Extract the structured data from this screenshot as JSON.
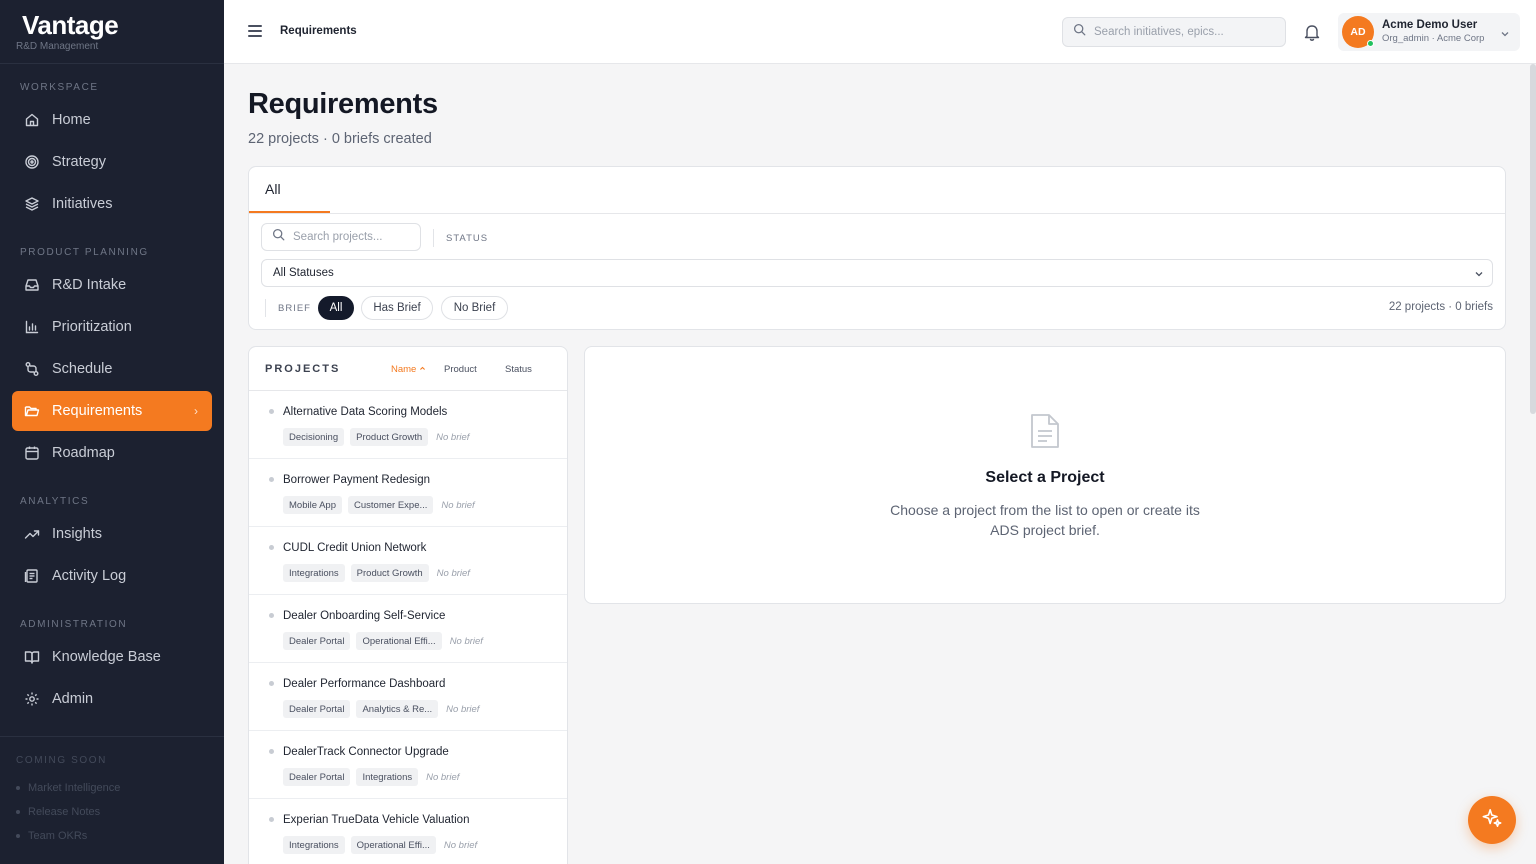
{
  "brand": {
    "name": "Vantage",
    "subtitle": "R&D Management"
  },
  "sidebar": {
    "sections": [
      {
        "label": "WORKSPACE"
      },
      {
        "label": "PRODUCT PLANNING"
      },
      {
        "label": "ANALYTICS"
      },
      {
        "label": "ADMINISTRATION"
      }
    ],
    "items": [
      {
        "label": "Home",
        "icon": "home-icon"
      },
      {
        "label": "Strategy",
        "icon": "target-icon"
      },
      {
        "label": "Initiatives",
        "icon": "layers-icon"
      },
      {
        "label": "R&D Intake",
        "icon": "inbox-icon"
      },
      {
        "label": "Prioritization",
        "icon": "bar-chart-icon"
      },
      {
        "label": "Schedule",
        "icon": "route-icon"
      },
      {
        "label": "Requirements",
        "icon": "folder-icon",
        "active": true
      },
      {
        "label": "Roadmap",
        "icon": "calendar-icon"
      },
      {
        "label": "Insights",
        "icon": "trend-icon"
      },
      {
        "label": "Activity Log",
        "icon": "log-icon"
      },
      {
        "label": "Knowledge Base",
        "icon": "book-icon"
      },
      {
        "label": "Admin",
        "icon": "gear-icon"
      }
    ],
    "coming_soon": {
      "label": "COMING SOON",
      "items": [
        "Market Intelligence",
        "Release Notes",
        "Team OKRs"
      ]
    }
  },
  "header": {
    "breadcrumb": "Requirements",
    "search_placeholder": "Search initiatives, epics...",
    "user": {
      "initials": "AD",
      "name": "Acme Demo User",
      "role": "Org_admin · Acme Corp"
    }
  },
  "page": {
    "title": "Requirements",
    "subtitle": "22 projects · 0 briefs created"
  },
  "filters": {
    "tab": "All",
    "search_placeholder": "Search projects...",
    "status_label": "STATUS",
    "status_value": "All Statuses",
    "brief_label": "BRIEF",
    "brief_options": [
      "All",
      "Has Brief",
      "No Brief"
    ],
    "brief_selected": "All",
    "summary": "22 projects · 0 briefs"
  },
  "projects": {
    "title": "PROJECTS",
    "sort_options": [
      "Name",
      "Product",
      "Status"
    ],
    "sort_active": "Name",
    "rows": [
      {
        "name": "Alternative Data Scoring Models",
        "tags": [
          "Decisioning",
          "Product Growth"
        ],
        "brief": "No brief"
      },
      {
        "name": "Borrower Payment Redesign",
        "tags": [
          "Mobile App",
          "Customer Expe..."
        ],
        "brief": "No brief"
      },
      {
        "name": "CUDL Credit Union Network",
        "tags": [
          "Integrations",
          "Product Growth"
        ],
        "brief": "No brief"
      },
      {
        "name": "Dealer Onboarding Self-Service",
        "tags": [
          "Dealer Portal",
          "Operational Effi..."
        ],
        "brief": "No brief"
      },
      {
        "name": "Dealer Performance Dashboard",
        "tags": [
          "Dealer Portal",
          "Analytics & Re..."
        ],
        "brief": "No brief"
      },
      {
        "name": "DealerTrack Connector Upgrade",
        "tags": [
          "Dealer Portal",
          "Integrations"
        ],
        "brief": "No brief"
      },
      {
        "name": "Experian TrueData Vehicle Valuation",
        "tags": [
          "Integrations",
          "Operational Effi..."
        ],
        "brief": "No brief"
      }
    ]
  },
  "empty_state": {
    "title": "Select a Project",
    "description": "Choose a project from the list to open or create its ADS project brief."
  },
  "colors": {
    "accent": "#f47a20",
    "sidebar": "#1c2130",
    "active_pill": "#141a2b"
  }
}
